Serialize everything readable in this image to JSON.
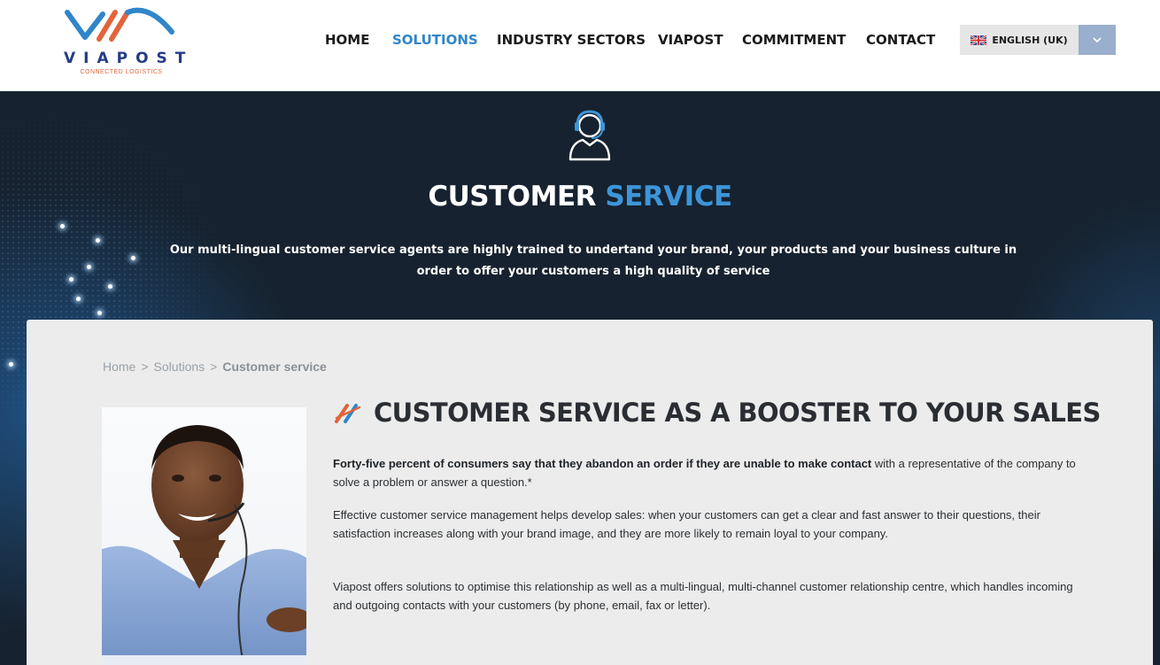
{
  "brand": {
    "name": "VIAPOST",
    "tagline": "CONNECTED LOGISTICS",
    "colors": {
      "primary": "#233c86",
      "accent": "#e3633a",
      "link": "#2f86c9"
    }
  },
  "nav": {
    "items": [
      {
        "label": "HOME",
        "active": false
      },
      {
        "label": "SOLUTIONS",
        "active": true
      },
      {
        "label": "INDUSTRY SECTORS",
        "active": false
      },
      {
        "label": "VIAPOST",
        "active": false
      },
      {
        "label": "COMMITMENT",
        "active": false
      },
      {
        "label": "CONTACT",
        "active": false
      }
    ]
  },
  "language": {
    "selected": "ENGLISH (UK)",
    "flag_icon": "uk-flag-icon",
    "dropdown_icon": "chevron-down-icon"
  },
  "hero": {
    "icon": "headset-agent-icon",
    "title_main": "CUSTOMER",
    "title_accent": "SERVICE",
    "text": "Our multi-lingual customer service agents are highly trained to undertand your brand, your products and your business culture in order to offer your customers a high quality of service"
  },
  "breadcrumb": {
    "home": "Home",
    "solutions": "Solutions",
    "current": "Customer service",
    "separator": ">"
  },
  "content": {
    "heading": "CUSTOMER SERVICE AS A BOOSTER TO YOUR SALES",
    "heading_icon": "double-slash-icon",
    "p1_bold": "Forty-five percent of consumers say that they abandon an order if they are unable to make contact",
    "p1_rest": " with a representative of the company to solve a problem or answer a question.*",
    "p2": "Effective customer service management helps develop sales: when your customers can get a clear and fast answer to their questions, their satisfaction increases along with your brand image, and they are more likely to remain loyal to your company.",
    "p3": "Viapost offers solutions to optimise this relationship as well as a multi-lingual, multi-channel customer relationship centre, which handles incoming and outgoing contacts with your customers (by phone, email, fax or letter).",
    "photo": "customer-service-agent-photo"
  }
}
